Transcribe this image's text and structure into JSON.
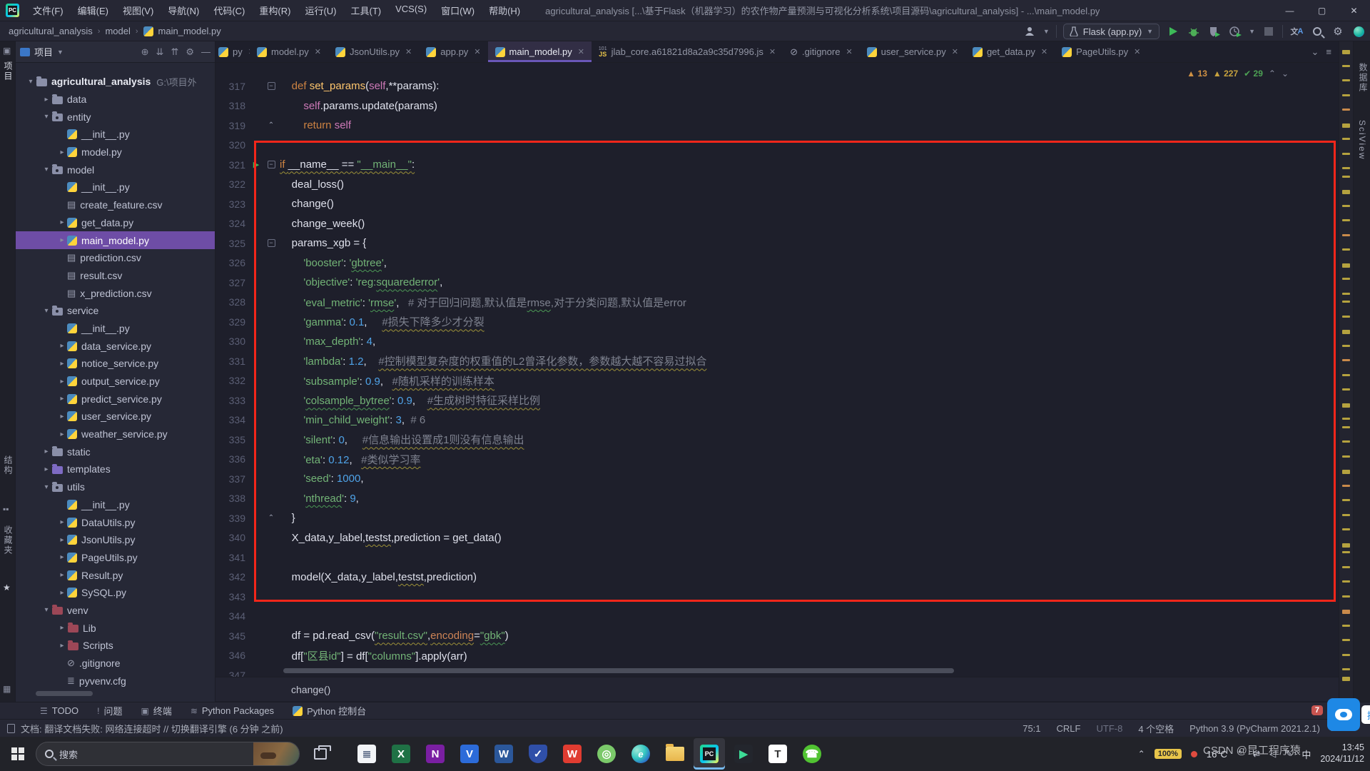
{
  "window": {
    "title": "agricultural_analysis [...\\基于Flask（机器学习）的农作物产量预测与可视化分析系统\\项目源码\\agricultural_analysis] - ...\\main_model.py",
    "controls": {
      "minimize": "—",
      "maximize": "▢",
      "close": "✕"
    }
  },
  "menubar": [
    "文件(F)",
    "编辑(E)",
    "视图(V)",
    "导航(N)",
    "代码(C)",
    "重构(R)",
    "运行(U)",
    "工具(T)",
    "VCS(S)",
    "窗口(W)",
    "帮助(H)"
  ],
  "toolbar": {
    "breadcrumb": [
      "agricultural_analysis",
      "model",
      "main_model.py"
    ],
    "run_config": "Flask (app.py)"
  },
  "left_strip": {
    "project_label": "项目",
    "structure_label": "结构",
    "favorites_label": "收藏夹"
  },
  "right_strip": {
    "labels": [
      "数据库",
      "SciView"
    ]
  },
  "project_panel": {
    "header": "项目",
    "tree": [
      {
        "label": "agricultural_analysis",
        "hint": "G:\\项目外",
        "icon": "dir",
        "arrow": "down",
        "depth": 0,
        "bold": true
      },
      {
        "label": "data",
        "icon": "dir",
        "arrow": "right",
        "depth": 1
      },
      {
        "label": "entity",
        "icon": "pkg",
        "arrow": "down",
        "depth": 1
      },
      {
        "label": "__init__.py",
        "icon": "py",
        "arrow": "none",
        "depth": 2
      },
      {
        "label": "model.py",
        "icon": "py",
        "arrow": "right",
        "depth": 2
      },
      {
        "label": "model",
        "icon": "pkg",
        "arrow": "down",
        "depth": 1
      },
      {
        "label": "__init__.py",
        "icon": "py",
        "arrow": "none",
        "depth": 2
      },
      {
        "label": "create_feature.csv",
        "icon": "csv",
        "arrow": "none",
        "depth": 2
      },
      {
        "label": "get_data.py",
        "icon": "py",
        "arrow": "right",
        "depth": 2
      },
      {
        "label": "main_model.py",
        "icon": "py",
        "arrow": "right",
        "depth": 2,
        "selected": true
      },
      {
        "label": "prediction.csv",
        "icon": "csv",
        "arrow": "none",
        "depth": 2
      },
      {
        "label": "result.csv",
        "icon": "csv",
        "arrow": "none",
        "depth": 2
      },
      {
        "label": "x_prediction.csv",
        "icon": "csv",
        "arrow": "none",
        "depth": 2
      },
      {
        "label": "service",
        "icon": "pkg",
        "arrow": "down",
        "depth": 1
      },
      {
        "label": "__init__.py",
        "icon": "py",
        "arrow": "none",
        "depth": 2
      },
      {
        "label": "data_service.py",
        "icon": "py",
        "arrow": "right",
        "depth": 2
      },
      {
        "label": "notice_service.py",
        "icon": "py",
        "arrow": "right",
        "depth": 2
      },
      {
        "label": "output_service.py",
        "icon": "py",
        "arrow": "right",
        "depth": 2
      },
      {
        "label": "predict_service.py",
        "icon": "py",
        "arrow": "right",
        "depth": 2
      },
      {
        "label": "user_service.py",
        "icon": "py",
        "arrow": "right",
        "depth": 2
      },
      {
        "label": "weather_service.py",
        "icon": "py",
        "arrow": "right",
        "depth": 2
      },
      {
        "label": "static",
        "icon": "dir",
        "arrow": "right",
        "depth": 1
      },
      {
        "label": "templates",
        "icon": "dir-purple",
        "arrow": "right",
        "depth": 1
      },
      {
        "label": "utils",
        "icon": "pkg",
        "arrow": "down",
        "depth": 1
      },
      {
        "label": "__init__.py",
        "icon": "py",
        "arrow": "none",
        "depth": 2
      },
      {
        "label": "DataUtils.py",
        "icon": "py",
        "arrow": "right",
        "depth": 2
      },
      {
        "label": "JsonUtils.py",
        "icon": "py",
        "arrow": "right",
        "depth": 2
      },
      {
        "label": "PageUtils.py",
        "icon": "py",
        "arrow": "right",
        "depth": 2
      },
      {
        "label": "Result.py",
        "icon": "py",
        "arrow": "right",
        "depth": 2
      },
      {
        "label": "SySQL.py",
        "icon": "py",
        "arrow": "right",
        "depth": 2
      },
      {
        "label": "venv",
        "icon": "dir-red",
        "arrow": "down",
        "depth": 1
      },
      {
        "label": "Lib",
        "icon": "dir-red",
        "arrow": "right",
        "depth": 2
      },
      {
        "label": "Scripts",
        "icon": "dir-red",
        "arrow": "right",
        "depth": 2
      },
      {
        "label": ".gitignore",
        "icon": "ignore",
        "arrow": "none",
        "depth": 2
      },
      {
        "label": "pyvenv.cfg",
        "icon": "cfg",
        "arrow": "none",
        "depth": 2
      }
    ]
  },
  "tabs": [
    {
      "label": "py",
      "icon": "py",
      "partial": true
    },
    {
      "label": "model.py",
      "icon": "py"
    },
    {
      "label": "JsonUtils.py",
      "icon": "py"
    },
    {
      "label": "app.py",
      "icon": "py"
    },
    {
      "label": "main_model.py",
      "icon": "py",
      "active": true
    },
    {
      "label": "jlab_core.a61821d8a2a9c35d7996.js",
      "icon": "js"
    },
    {
      "label": ".gitignore",
      "icon": "ignore"
    },
    {
      "label": "user_service.py",
      "icon": "py"
    },
    {
      "label": "get_data.py",
      "icon": "py"
    },
    {
      "label": "PageUtils.py",
      "icon": "py"
    }
  ],
  "inspections": [
    {
      "kind": "warning",
      "count": "13"
    },
    {
      "kind": "weak-warning",
      "count": "227"
    },
    {
      "kind": "ok",
      "count": "29"
    }
  ],
  "editor": {
    "context_line": "change()",
    "lines": [
      {
        "n": "317",
        "fold": "minus",
        "seg": [
          [
            "p",
            "    "
          ],
          [
            "k",
            "def "
          ],
          [
            "f",
            "set_params"
          ],
          [
            "p",
            "("
          ],
          [
            "sm",
            "self"
          ],
          [
            "p",
            ",**params):"
          ]
        ]
      },
      {
        "n": "318",
        "seg": [
          [
            "p",
            "        "
          ],
          [
            "sm",
            "self"
          ],
          [
            "p",
            ".params.update(params)"
          ]
        ]
      },
      {
        "n": "319",
        "fold": "up",
        "seg": [
          [
            "p",
            "        "
          ],
          [
            "k",
            "return "
          ],
          [
            "sm",
            "self"
          ]
        ]
      },
      {
        "n": "320",
        "seg": []
      },
      {
        "n": "321",
        "run": true,
        "fold": "minus",
        "seg": [
          [
            "k",
            "if ",
            "y"
          ],
          [
            "p",
            "__name__ == ",
            "y"
          ],
          [
            "s",
            "\"__main__\"",
            "y"
          ],
          [
            "p",
            ":",
            "y"
          ]
        ]
      },
      {
        "n": "322",
        "seg": [
          [
            "p",
            "    deal_loss()"
          ]
        ]
      },
      {
        "n": "323",
        "seg": [
          [
            "p",
            "    change()"
          ]
        ]
      },
      {
        "n": "324",
        "seg": [
          [
            "p",
            "    change_week()"
          ]
        ]
      },
      {
        "n": "325",
        "fold": "minus",
        "seg": [
          [
            "p",
            "    params_xgb = {"
          ]
        ]
      },
      {
        "n": "326",
        "seg": [
          [
            "p",
            "        "
          ],
          [
            "s",
            "'booster'"
          ],
          [
            "p",
            ": "
          ],
          [
            "s",
            "'"
          ],
          [
            "s",
            "gbtree",
            "g"
          ],
          [
            "s",
            "'"
          ],
          [
            "p",
            ","
          ]
        ]
      },
      {
        "n": "327",
        "seg": [
          [
            "p",
            "        "
          ],
          [
            "s",
            "'objective'"
          ],
          [
            "p",
            ": "
          ],
          [
            "s",
            "'reg:"
          ],
          [
            "s",
            "squarederror",
            "g"
          ],
          [
            "s",
            "'"
          ],
          [
            "p",
            ","
          ]
        ]
      },
      {
        "n": "328",
        "seg": [
          [
            "p",
            "        "
          ],
          [
            "s",
            "'eval_metric'"
          ],
          [
            "p",
            ": "
          ],
          [
            "s",
            "'"
          ],
          [
            "s",
            "rmse",
            "g"
          ],
          [
            "s",
            "'"
          ],
          [
            "p",
            ",   "
          ],
          [
            "c",
            "# 对于回归问题,默认值是"
          ],
          [
            "c",
            "rmse",
            "g"
          ],
          [
            "c",
            ",对于分类问题,默认值是error"
          ]
        ]
      },
      {
        "n": "329",
        "seg": [
          [
            "p",
            "        "
          ],
          [
            "s",
            "'gamma'"
          ],
          [
            "p",
            ": "
          ],
          [
            "n",
            "0.1"
          ],
          [
            "p",
            ",     "
          ],
          [
            "c",
            "#损失下降多少才分裂",
            "y"
          ]
        ]
      },
      {
        "n": "330",
        "seg": [
          [
            "p",
            "        "
          ],
          [
            "s",
            "'max_depth'"
          ],
          [
            "p",
            ": "
          ],
          [
            "n",
            "4"
          ],
          [
            "p",
            ","
          ]
        ]
      },
      {
        "n": "331",
        "seg": [
          [
            "p",
            "        "
          ],
          [
            "s",
            "'lambda'"
          ],
          [
            "p",
            ": "
          ],
          [
            "n",
            "1.2"
          ],
          [
            "p",
            ",    "
          ],
          [
            "c",
            "#控制模型复杂度的权重值的L2曾泽化参数，参数越大越不容易过拟合",
            "y"
          ]
        ]
      },
      {
        "n": "332",
        "seg": [
          [
            "p",
            "        "
          ],
          [
            "s",
            "'subsample'"
          ],
          [
            "p",
            ": "
          ],
          [
            "n",
            "0.9"
          ],
          [
            "p",
            ",   "
          ],
          [
            "c",
            "#随机采样的训练样本",
            "y"
          ]
        ]
      },
      {
        "n": "333",
        "seg": [
          [
            "p",
            "        "
          ],
          [
            "s",
            "'"
          ],
          [
            "s",
            "colsample_bytree",
            "g"
          ],
          [
            "s",
            "'"
          ],
          [
            "p",
            ": "
          ],
          [
            "n",
            "0.9"
          ],
          [
            "p",
            ",    "
          ],
          [
            "c",
            "#生成树时特征采样比例",
            "y"
          ]
        ]
      },
      {
        "n": "334",
        "seg": [
          [
            "p",
            "        "
          ],
          [
            "s",
            "'min_child_weight'"
          ],
          [
            "p",
            ": "
          ],
          [
            "n",
            "3"
          ],
          [
            "p",
            ",  "
          ],
          [
            "c",
            "# 6"
          ]
        ]
      },
      {
        "n": "335",
        "seg": [
          [
            "p",
            "        "
          ],
          [
            "s",
            "'silent'"
          ],
          [
            "p",
            ": "
          ],
          [
            "n",
            "0"
          ],
          [
            "p",
            ",     "
          ],
          [
            "c",
            "#信息输出设置成1则没有信息输出",
            "y"
          ]
        ]
      },
      {
        "n": "336",
        "seg": [
          [
            "p",
            "        "
          ],
          [
            "s",
            "'eta'"
          ],
          [
            "p",
            ": "
          ],
          [
            "n",
            "0.12"
          ],
          [
            "p",
            ",   "
          ],
          [
            "c",
            "#类似学习率",
            "y"
          ]
        ]
      },
      {
        "n": "337",
        "seg": [
          [
            "p",
            "        "
          ],
          [
            "s",
            "'seed'"
          ],
          [
            "p",
            ": "
          ],
          [
            "n",
            "1000"
          ],
          [
            "p",
            ","
          ]
        ]
      },
      {
        "n": "338",
        "seg": [
          [
            "p",
            "        "
          ],
          [
            "s",
            "'"
          ],
          [
            "s",
            "nthread",
            "g"
          ],
          [
            "s",
            "'"
          ],
          [
            "p",
            ": "
          ],
          [
            "n",
            "9"
          ],
          [
            "p",
            ","
          ]
        ]
      },
      {
        "n": "339",
        "fold": "up",
        "seg": [
          [
            "p",
            "    }"
          ]
        ]
      },
      {
        "n": "340",
        "seg": [
          [
            "p",
            "    X_data,y_label,"
          ],
          [
            "p",
            "testst",
            "y"
          ],
          [
            "p",
            ",prediction = get_data()"
          ]
        ]
      },
      {
        "n": "341",
        "seg": []
      },
      {
        "n": "342",
        "seg": [
          [
            "p",
            "    model(X_data,y_label,"
          ],
          [
            "p",
            "testst",
            "y"
          ],
          [
            "p",
            ",prediction)"
          ]
        ]
      },
      {
        "n": "343",
        "seg": []
      },
      {
        "n": "344",
        "seg": []
      },
      {
        "n": "345",
        "seg": [
          [
            "p",
            "    df = pd.read_csv("
          ],
          [
            "s",
            "\"result.csv\"",
            "y"
          ],
          [
            "p",
            ","
          ],
          [
            "kw",
            "encoding",
            "y"
          ],
          [
            "p",
            "="
          ],
          [
            "s",
            "\"gbk\"",
            "g"
          ],
          [
            "p",
            ")"
          ]
        ]
      },
      {
        "n": "346",
        "seg": [
          [
            "p",
            "    df["
          ],
          [
            "s",
            "\"区县id\""
          ],
          [
            "p",
            "] = "
          ],
          [
            "p",
            "df["
          ],
          [
            "s",
            "\"columns\""
          ],
          [
            "p",
            "].apply(arr)"
          ]
        ]
      },
      {
        "n": "347",
        "seg": []
      }
    ]
  },
  "tool_windows": [
    {
      "icon": "☰",
      "label": "TODO"
    },
    {
      "icon": "!",
      "label": "问题"
    },
    {
      "icon": "▣",
      "label": "终端"
    },
    {
      "icon": "≋",
      "label": "Python Packages"
    },
    {
      "icon": "py",
      "label": "Python 控制台"
    }
  ],
  "event_badge": "7",
  "statusbar": {
    "left": "文档: 翻译文档失败: 网络连接超时 // 切换翻译引擎 (6 分钟 之前)",
    "items": [
      "75:1",
      "CRLF",
      "UTF-8",
      "4 个空格",
      "Python 3.9 (PyCharm 2021.2.1)"
    ]
  },
  "taskbar": {
    "search_placeholder": "搜索",
    "icons": [
      {
        "name": "notes-app",
        "glyph": "≣",
        "bg": "#F2F4F7",
        "fg": "#4A5A7A"
      },
      {
        "name": "excel",
        "glyph": "X",
        "bg": "#1F7145",
        "fg": "#FFFFFF"
      },
      {
        "name": "onenote",
        "glyph": "N",
        "bg": "#7A1FA2",
        "fg": "#FFFFFF"
      },
      {
        "name": "v-app",
        "glyph": "V",
        "bg": "#2C6BD9",
        "fg": "#FFFFFF"
      },
      {
        "name": "word",
        "glyph": "W",
        "bg": "#2B579A",
        "fg": "#FFFFFF"
      },
      {
        "name": "defender",
        "glyph": "✓",
        "bg": "#2F4FA8",
        "fg": "#FFFFFF",
        "shape": "shield"
      },
      {
        "name": "wps",
        "glyph": "W",
        "bg": "#E03C31",
        "fg": "#FFFFFF"
      },
      {
        "name": "green-app",
        "glyph": "◎",
        "bg": "#7BC96A",
        "fg": "#FFFFFF",
        "shape": "round"
      },
      {
        "name": "edge",
        "special": "edge",
        "glyph": "e"
      },
      {
        "name": "file-explorer",
        "special": "folder"
      },
      {
        "name": "pycharm",
        "special": "pycharm",
        "active": true
      },
      {
        "name": "dark-ide",
        "glyph": "▶",
        "bg": "#23262D",
        "fg": "#3DDC97"
      },
      {
        "name": "typora",
        "glyph": "T",
        "bg": "#FFFFFF",
        "fg": "#333333"
      },
      {
        "name": "wechat",
        "glyph": "☎",
        "bg": "#51C332",
        "fg": "#FFFFFF",
        "shape": "round"
      }
    ],
    "tray": {
      "battery": "100%",
      "temp": "16°C",
      "ime": "中",
      "time": "13:45",
      "date": "2024/11/12"
    }
  },
  "overlays": {
    "cloud_tooltip": "拖拽",
    "watermark": "CSDN @昆工程序猿"
  }
}
